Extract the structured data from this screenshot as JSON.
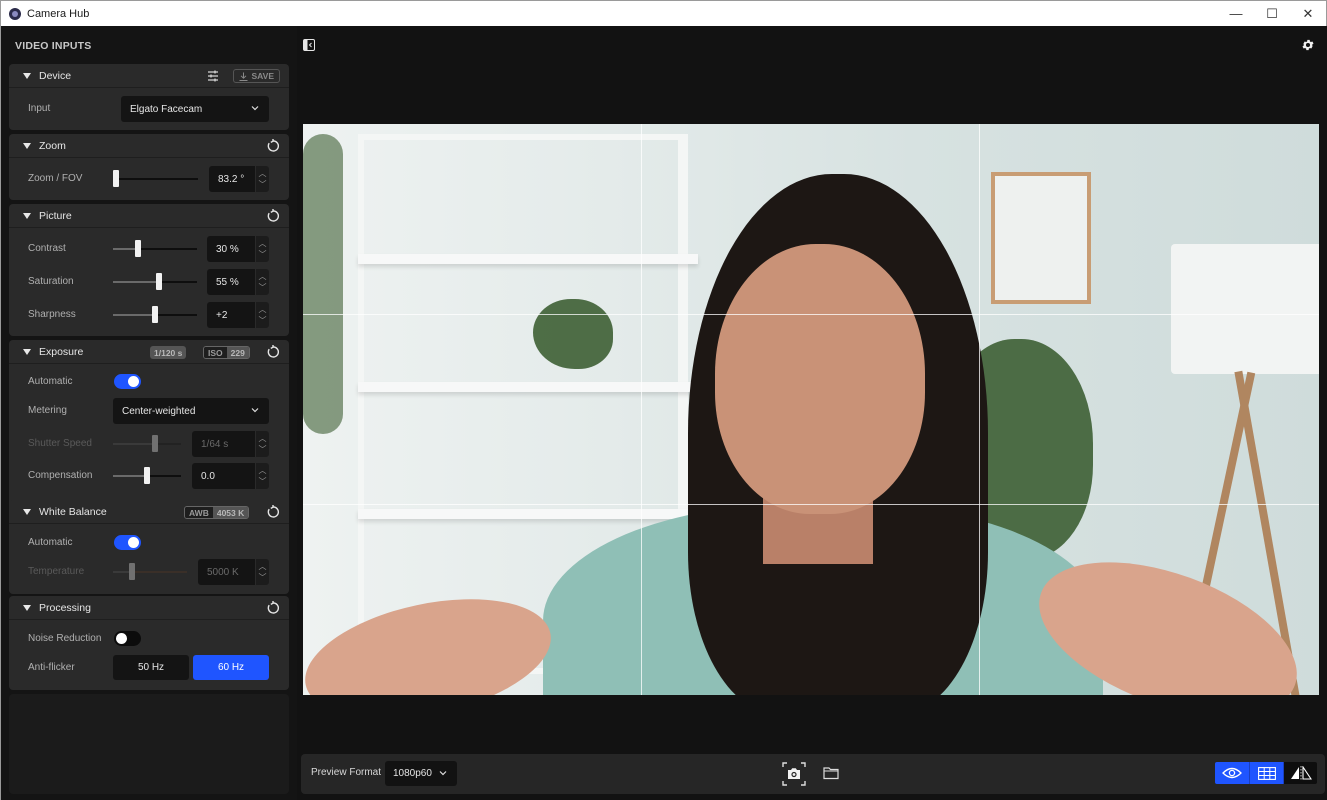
{
  "window": {
    "title": "Camera Hub",
    "controls": {
      "minimize": "—",
      "maximize": "☐",
      "close": "✕"
    }
  },
  "sidebar": {
    "title": "VIDEO INPUTS",
    "device": {
      "title": "Device",
      "save_label": "SAVE",
      "input_label": "Input",
      "input_value": "Elgato Facecam"
    },
    "zoom": {
      "title": "Zoom",
      "fov_label": "Zoom / FOV",
      "fov_value": "83.2 °",
      "fov_slider_fraction": 0.02
    },
    "picture": {
      "title": "Picture",
      "rows": [
        {
          "label": "Contrast",
          "value": "30 %",
          "fraction": 0.3
        },
        {
          "label": "Saturation",
          "value": "55 %",
          "fraction": 0.55
        },
        {
          "label": "Sharpness",
          "value": "+2",
          "fraction": 0.5
        }
      ]
    },
    "exposure": {
      "title": "Exposure",
      "shutter_badge": "1/120 s",
      "iso_badge_label": "ISO",
      "iso_badge_value": "229",
      "automatic_label": "Automatic",
      "automatic_on": true,
      "metering_label": "Metering",
      "metering_value": "Center-weighted",
      "shutter_label": "Shutter Speed",
      "shutter_value": "1/64 s",
      "shutter_fraction": 0.62,
      "shutter_disabled": true,
      "compensation_label": "Compensation",
      "compensation_value": "0.0",
      "compensation_fraction": 0.5
    },
    "white_balance": {
      "title": "White Balance",
      "awb_badge_label": "AWB",
      "awb_badge_value": "4053 K",
      "automatic_label": "Automatic",
      "automatic_on": true,
      "temperature_label": "Temperature",
      "temperature_value": "5000 K",
      "temperature_fraction": 0.25,
      "temperature_disabled": true
    },
    "processing": {
      "title": "Processing",
      "noise_label": "Noise Reduction",
      "noise_on": false,
      "antiflicker_label": "Anti-flicker",
      "antiflicker_options": [
        "50 Hz",
        "60 Hz"
      ],
      "antiflicker_selected": "60 Hz"
    }
  },
  "bottombar": {
    "preview_format_label": "Preview Format",
    "preview_format_value": "1080p60",
    "view_toggles": [
      {
        "name": "preview-visibility",
        "on": true
      },
      {
        "name": "grid-overlay",
        "on": true
      },
      {
        "name": "mirror",
        "on": false
      }
    ]
  },
  "colors": {
    "accent": "#1f55ff",
    "panel": "#2a2a2a",
    "background": "#121212"
  }
}
